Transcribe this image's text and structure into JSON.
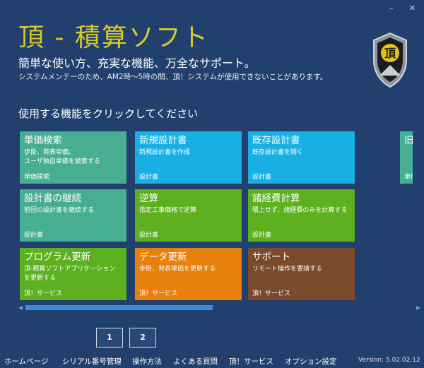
{
  "window": {
    "minimize_glyph": "–",
    "close_glyph": "✕"
  },
  "header": {
    "title": "頂 - 積算ソフト",
    "tagline": "簡単な使い方、充実な機能、万全なサポート。",
    "notice": "システムメンテーのため、AM2時～5時の間、頂！システムが使用できないことがあります。"
  },
  "emblem": {
    "icon": "shield-emblem-icon",
    "glyph": "頂"
  },
  "main": {
    "prompt": "使用する機能をクリックしてください",
    "tiles": [
      {
        "name": "単価検索",
        "desc": "歩掛、発表単価、\nユーザ独自単価を検索する",
        "category": "単価検索"
      },
      {
        "name": "新規設計書",
        "desc": "新規設計書を作成",
        "category": "設計書"
      },
      {
        "name": "既存設計書",
        "desc": "既存設計書を開く",
        "category": "設計書"
      },
      {
        "name": "旧単",
        "desc": "",
        "category": "単価"
      },
      {
        "name": "設計書の継続",
        "desc": "前回の設計書を継続する",
        "category": "設計書"
      },
      {
        "name": "逆算",
        "desc": "指定工事価格で逆算",
        "category": "設計書"
      },
      {
        "name": "諸経費計算",
        "desc": "積上せず、諸経費のみを計算する",
        "category": "設計書"
      },
      {
        "name": "プログラム更新",
        "desc": "頂-積算ソフトアプリケーション\nを更新する",
        "category": "頂！サービス"
      },
      {
        "name": "データ更新",
        "desc": "歩掛、発表単価を更新する",
        "category": "頂！サービス"
      },
      {
        "name": "サポート",
        "desc": "リモート操作を要請する",
        "category": "頂！サービス"
      }
    ],
    "colors": {
      "teal": "#47ae94",
      "cyan": "#18afe2",
      "green": "#5db01f",
      "orange": "#e7800c",
      "brown": "#7a4a2c"
    }
  },
  "scrollbar": {
    "left_glyph": "◀",
    "right_glyph": "▶"
  },
  "pagination": {
    "pages": [
      "1",
      "2"
    ]
  },
  "footer": {
    "links": [
      "ホームページ",
      "シリアル番号管理",
      "操作方法",
      "よくある質問",
      "頂！サービス",
      "オプション設定"
    ],
    "version": "Version: 5.02.02.12"
  }
}
